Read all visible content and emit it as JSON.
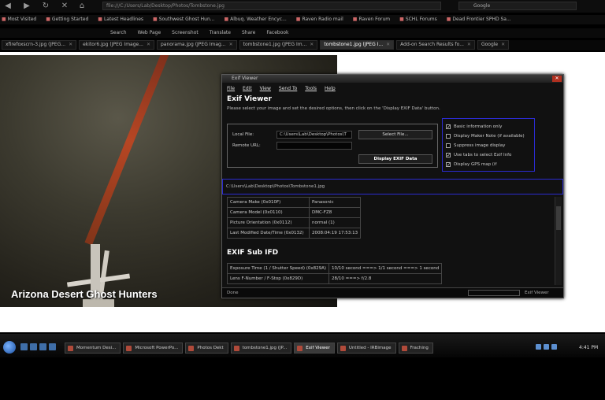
{
  "browser": {
    "address": "file:///C:/Users/Lab/Desktop/Photos/Tombstone.jpg",
    "search_placeholder": "Google",
    "bookmarks": [
      "Most Visited",
      "Getting Started",
      "Latest Headlines",
      "Southwest Ghost Hun...",
      "Albuq. Weather Encyc...",
      "Raven Radio mail",
      "Raven Forum",
      "SCHL Forums",
      "Dead Frontier SPHD Sa..."
    ],
    "toolbar": [
      "Search",
      "Web Page",
      "Screenshot",
      "Translate",
      "Share",
      "Facebook"
    ],
    "tabs": [
      {
        "label": "xfirefoxscrn-3.jpg (JPEG...",
        "active": false
      },
      {
        "label": "ekitor6.jpg (JPEG Image...",
        "active": false
      },
      {
        "label": "panorama.jpg (JPEG Imag...",
        "active": false
      },
      {
        "label": "tombstone1.jpg (JPEG Im...",
        "active": false
      },
      {
        "label": "tombstone1.jpg (JPEG I...",
        "active": true
      },
      {
        "label": "Add-on Search Results fo...",
        "active": false
      },
      {
        "label": "Google",
        "active": false
      }
    ]
  },
  "photo": {
    "watermark": "Arizona Desert Ghost Hunters"
  },
  "exif_window": {
    "title": "Exif Viewer",
    "menu": [
      "File",
      "Edit",
      "View",
      "Send To",
      "Tools",
      "Help"
    ],
    "heading": "Exif Viewer",
    "instructions": "Please select your image and set the desired options, then click on the 'Display EXIF Data' button.",
    "local_file_label": "Local File:",
    "local_file_value": "C:\\Users\\Lab\\Desktop\\Photos\\T",
    "remote_url_label": "Remote URL:",
    "select_file_button": "Select File...",
    "display_button": "Display EXIF Data",
    "options": [
      {
        "label": "Basic information only",
        "checked": true
      },
      {
        "label": "Display Maker Note (if available)",
        "checked": false
      },
      {
        "label": "Suppress image display",
        "checked": false
      },
      {
        "label": "Use tabs to select Exif Info",
        "checked": true
      },
      {
        "label": "Display GPS map (if",
        "checked": true
      }
    ],
    "path": "C:\\Users\\Lab\\Desktop\\Photos\\Tombstone1.jpg",
    "ifd0_rows": [
      [
        "Camera Make (0x010F)",
        "Panasonic"
      ],
      [
        "Camera Model (0x0110)",
        "DMC-FZ8"
      ],
      [
        "Picture Orientation (0x0112)",
        "normal (1)"
      ],
      [
        "Last Modified Date/Time (0x0132)",
        "2008:04:19 17:53:13"
      ]
    ],
    "sub_ifd_heading": "EXIF Sub IFD",
    "sub_ifd_rows": [
      [
        "Exposure Time (1 / Shutter Speed) (0x829A)",
        "10/10 second ===> 1/1 second ===> 1 second"
      ],
      [
        "Lens F-Number / F-Stop (0x829D)",
        "28/10 ===> f/2.8"
      ]
    ],
    "status_left": "Done",
    "status_right": "Exif Viewer"
  },
  "taskbar": {
    "tasks": [
      {
        "label": "Momentum Desi...",
        "active": false
      },
      {
        "label": "Microsoft PowerPo...",
        "active": false
      },
      {
        "label": "Photos Dekt",
        "active": false
      },
      {
        "label": "tombstone1.jpg (JP...",
        "active": false
      },
      {
        "label": "Exif Viewer",
        "active": true
      },
      {
        "label": "Untitled - IRBimage",
        "active": false
      },
      {
        "label": "Fraching",
        "active": false
      }
    ],
    "clock": "4:41 PM"
  }
}
